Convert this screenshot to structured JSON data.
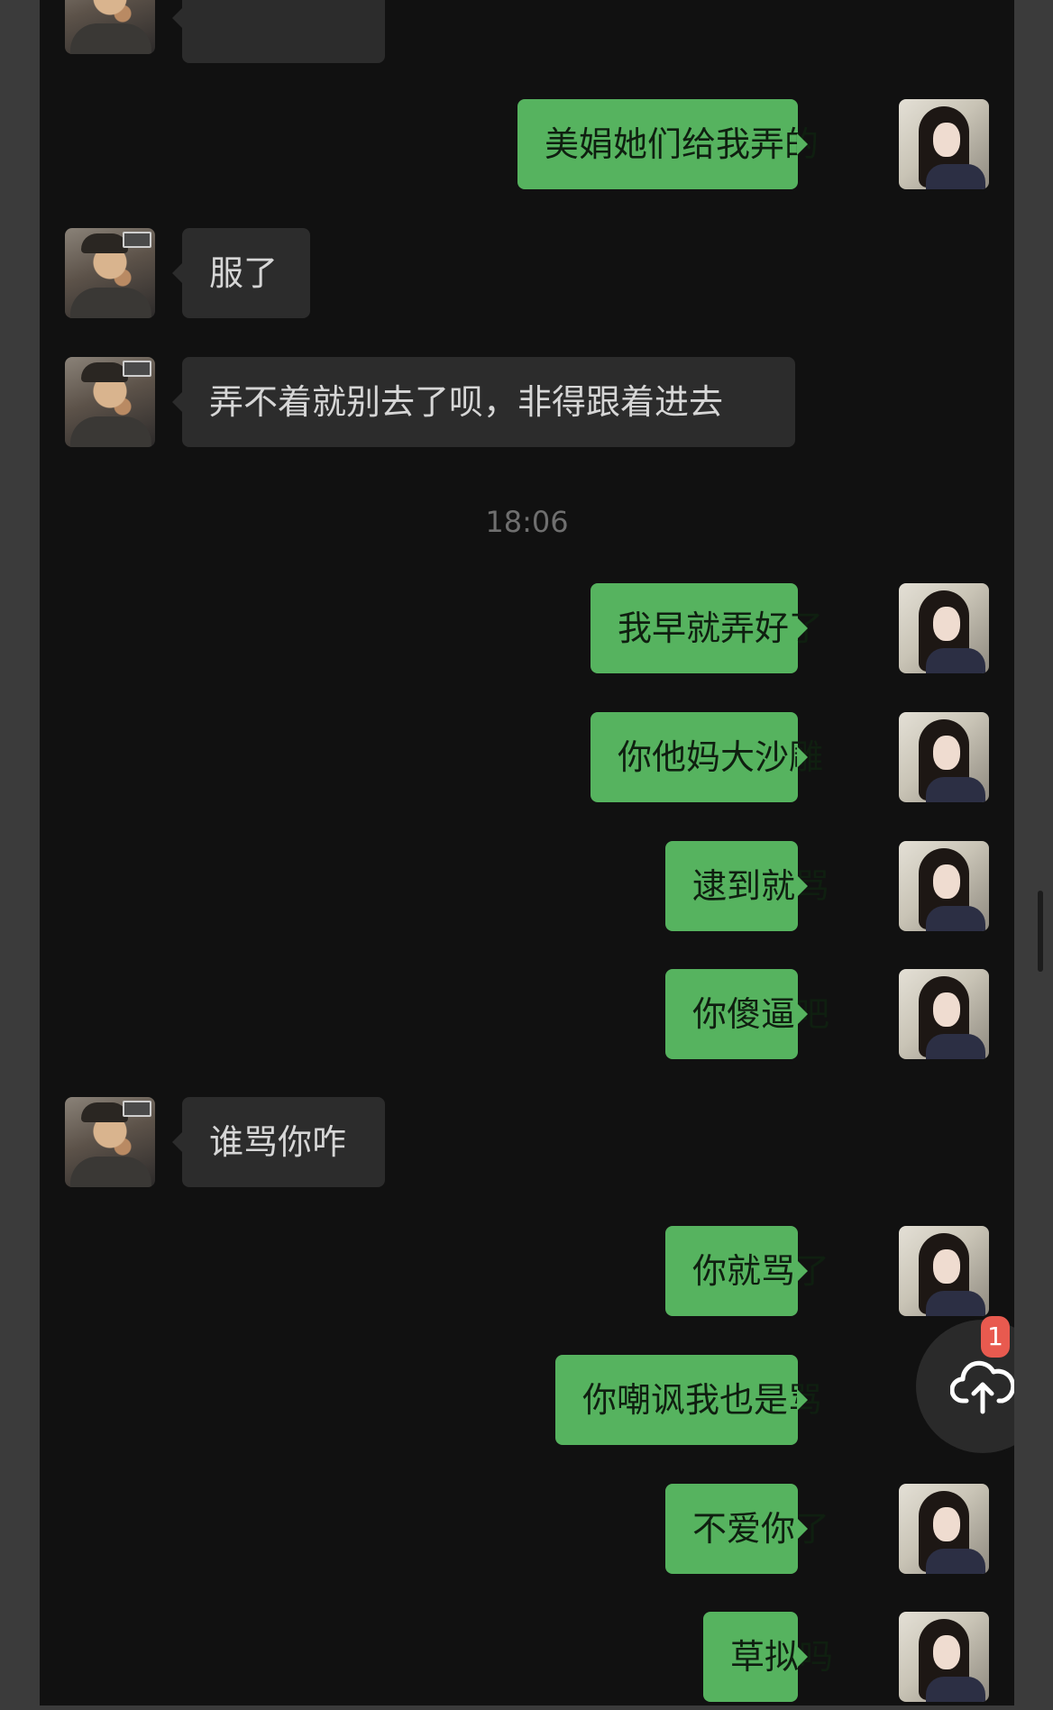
{
  "chat": {
    "timestamp": "18:06",
    "messages": [
      {
        "sender": "me",
        "text": "美娟她们给我弄的"
      },
      {
        "sender": "other",
        "text": "服了"
      },
      {
        "sender": "other",
        "text": "弄不着就别去了呗，非得跟着进去"
      },
      {
        "sender": "me",
        "text": "我早就弄好了"
      },
      {
        "sender": "me",
        "text": "你他妈大沙雕"
      },
      {
        "sender": "me",
        "text": "逮到就骂"
      },
      {
        "sender": "me",
        "text": "你傻逼吧"
      },
      {
        "sender": "other",
        "text": "谁骂你咋"
      },
      {
        "sender": "me",
        "text": "你就骂了"
      },
      {
        "sender": "me",
        "text": "你嘲讽我也是骂"
      },
      {
        "sender": "me",
        "text": "不爱你了"
      },
      {
        "sender": "me",
        "text": "草拟吗"
      }
    ]
  },
  "upload_button": {
    "icon": "cloud-upload-icon",
    "badge_count": "1"
  },
  "colors": {
    "background": "#111111",
    "incoming_bubble": "#2c2c2c",
    "outgoing_bubble": "#56b35f",
    "badge": "#e85a4f"
  }
}
